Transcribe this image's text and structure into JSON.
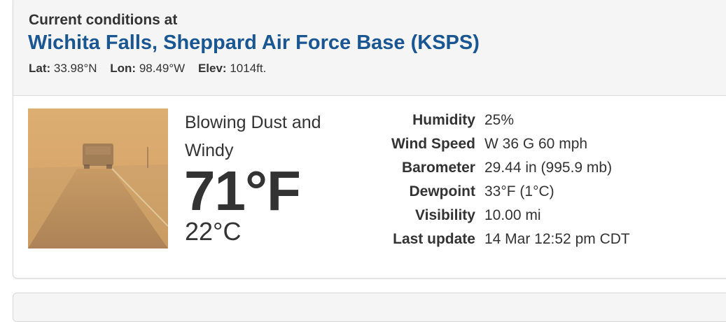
{
  "header": {
    "label": "Current conditions at",
    "station_name": "Wichita Falls, Sheppard Air Force Base (KSPS)",
    "lat_label": "Lat:",
    "lat_value": "33.98°N",
    "lon_label": "Lon:",
    "lon_value": "98.49°W",
    "elev_label": "Elev:",
    "elev_value": "1014ft."
  },
  "current": {
    "condition": "Blowing Dust and Windy",
    "temp_f": "71°F",
    "temp_c": "22°C",
    "image_icon": "blowing-dust-photo"
  },
  "details": [
    {
      "label": "Humidity",
      "value": "25%"
    },
    {
      "label": "Wind Speed",
      "value": "W 36 G 60 mph"
    },
    {
      "label": "Barometer",
      "value": "29.44 in (995.9 mb)"
    },
    {
      "label": "Dewpoint",
      "value": "33°F (1°C)"
    },
    {
      "label": "Visibility",
      "value": "10.00 mi"
    },
    {
      "label": "Last update",
      "value": "14 Mar 12:52 pm CDT"
    }
  ],
  "colors": {
    "station_link": "#1a5691",
    "panel_header_bg": "#f5f5f5",
    "dust_photo_tone": "#d9a86a"
  }
}
